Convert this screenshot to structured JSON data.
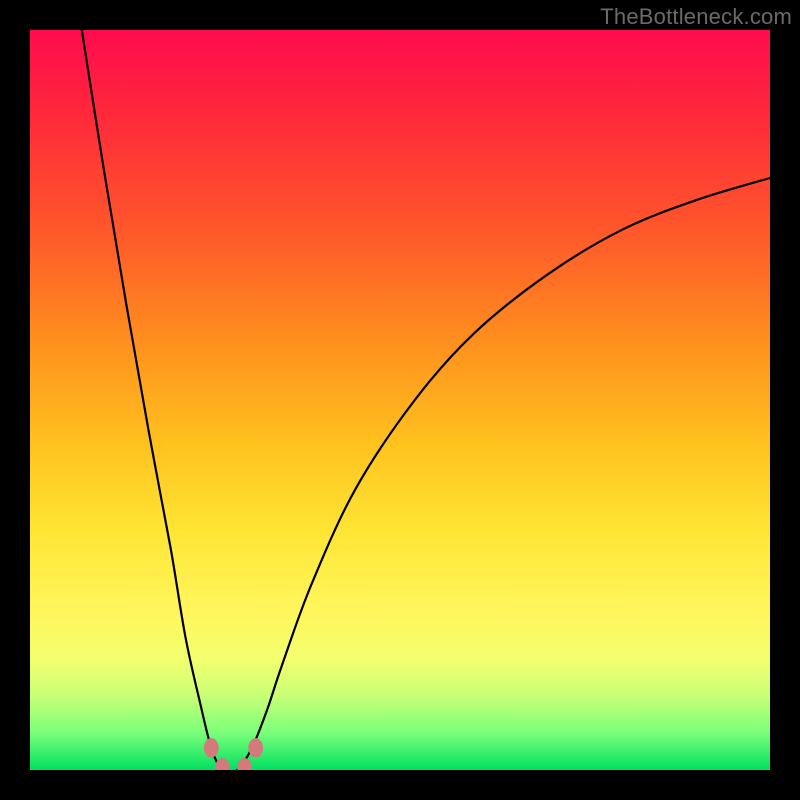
{
  "watermark": "TheBottleneck.com",
  "chart_data": {
    "type": "line",
    "title": "",
    "xlabel": "",
    "ylabel": "",
    "xlim": [
      0,
      100
    ],
    "ylim": [
      0,
      100
    ],
    "grid": false,
    "legend": false,
    "background_gradient": {
      "direction": "vertical",
      "stops": [
        {
          "pos": 0.0,
          "color": "#ff0b4d"
        },
        {
          "pos": 0.12,
          "color": "#ff2a3a"
        },
        {
          "pos": 0.28,
          "color": "#ff5a2a"
        },
        {
          "pos": 0.42,
          "color": "#ff8f1e"
        },
        {
          "pos": 0.56,
          "color": "#ffc21e"
        },
        {
          "pos": 0.68,
          "color": "#ffe635"
        },
        {
          "pos": 0.78,
          "color": "#fff55a"
        },
        {
          "pos": 0.85,
          "color": "#f4ff6e"
        },
        {
          "pos": 0.9,
          "color": "#c8ff76"
        },
        {
          "pos": 0.95,
          "color": "#7aff7a"
        },
        {
          "pos": 1.0,
          "color": "#00e060"
        }
      ]
    },
    "series": [
      {
        "name": "bottleneck-curve",
        "color": "#000000",
        "x": [
          7,
          10,
          13,
          16,
          19,
          21,
          23,
          24.5,
          26,
          28,
          30,
          32,
          34,
          38,
          44,
          52,
          60,
          70,
          80,
          90,
          100
        ],
        "y": [
          100,
          81,
          63,
          46,
          30,
          18,
          9,
          3,
          0,
          0,
          3,
          8,
          14,
          25,
          38,
          50,
          59,
          67,
          73,
          77,
          80
        ]
      }
    ],
    "markers": [
      {
        "x": 24.5,
        "y": 3.0,
        "color": "#d47a7a",
        "r": 1.0
      },
      {
        "x": 26.0,
        "y": 0.3,
        "color": "#d47a7a",
        "r": 1.0
      },
      {
        "x": 29.0,
        "y": 0.3,
        "color": "#d47a7a",
        "r": 1.0
      },
      {
        "x": 30.5,
        "y": 3.0,
        "color": "#d47a7a",
        "r": 1.0
      }
    ]
  }
}
